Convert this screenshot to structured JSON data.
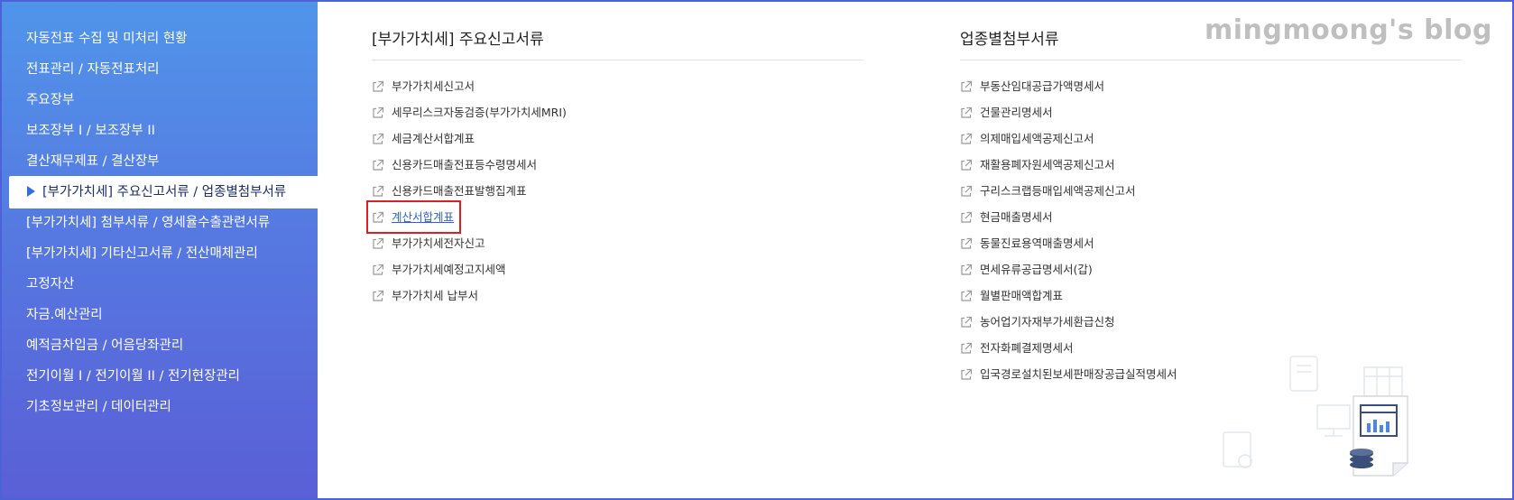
{
  "sidebar": {
    "items": [
      {
        "label": "자동전표 수집 및 미처리 현황"
      },
      {
        "label": "전표관리 / 자동전표처리"
      },
      {
        "label": "주요장부"
      },
      {
        "label": "보조장부 I / 보조장부 II"
      },
      {
        "label": "결산재무제표 / 결산장부"
      },
      {
        "label": "[부가가치세] 주요신고서류 / 업종별첨부서류",
        "active": true
      },
      {
        "label": "[부가가치세] 첨부서류 / 영세율수출관련서류"
      },
      {
        "label": "[부가가치세] 기타신고서류 / 전산매체관리"
      },
      {
        "label": "고정자산"
      },
      {
        "label": "자금.예산관리"
      },
      {
        "label": "예적금차입금 / 어음당좌관리"
      },
      {
        "label": "전기이월 Ⅰ / 전기이월 II / 전기현장관리"
      },
      {
        "label": "기초정보관리 / 데이터관리"
      }
    ]
  },
  "main": {
    "left_title": "[부가가치세] 주요신고서류",
    "left_items": [
      "부가가치세신고서",
      "세무리스크자동검증(부가가치세MRI)",
      "세금계산서합계표",
      "신용카드매출전표등수령명세서",
      "신용카드매출전표발행집계표",
      "계산서합계표",
      "부가가치세전자신고",
      "부가가치세예정고지세액",
      "부가가치세 납부서"
    ],
    "left_highlighted_index": 5,
    "right_title": "업종별첨부서류",
    "right_items": [
      "부동산임대공급가액명세서",
      "건물관리명세서",
      "의제매입세액공제신고서",
      "재활용폐자원세액공제신고서",
      "구리스크랩등매입세액공제신고서",
      "현금매출명세서",
      "동물진료용역매출명세서",
      "면세유류공급명세서(갑)",
      "월별판매액합계표",
      "농어업기자재부가세환급신청",
      "전자화폐결제명세서",
      "입국경로설치된보세판매장공급실적명세서"
    ]
  },
  "watermark": "mingmoong's blog",
  "colors": {
    "sidebar_top": "#5095ea",
    "sidebar_bottom": "#5a5fd6",
    "active_arrow": "#2e6fdc",
    "link_highlight": "#2f64cf",
    "highlight_border": "#e11d1d"
  }
}
